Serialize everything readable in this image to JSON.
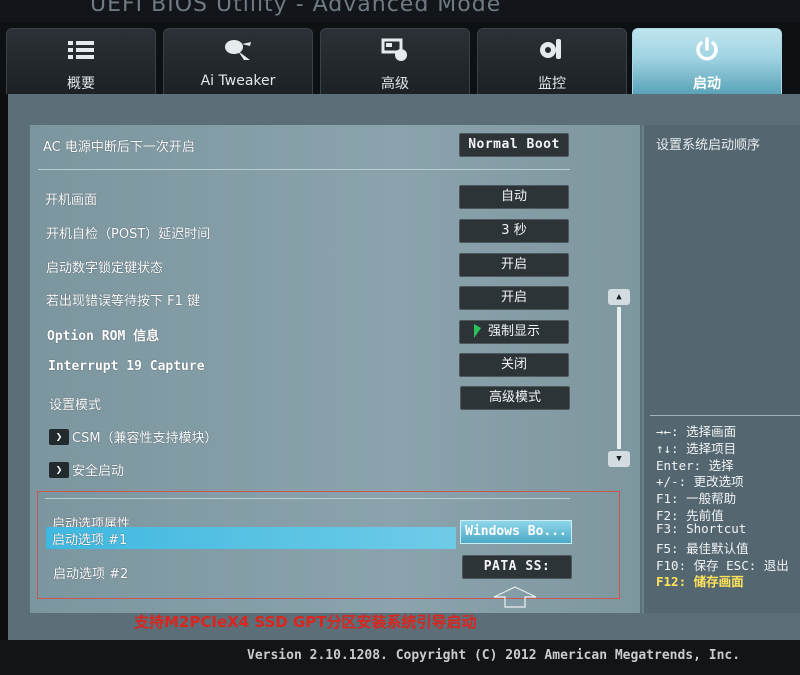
{
  "window": {
    "title": "UEFI BIOS Utility - Advanced Mode"
  },
  "tabs": [
    {
      "label": "概要",
      "icon": "list-icon"
    },
    {
      "label": "Ai Tweaker",
      "icon": "fan-icon"
    },
    {
      "label": "高级",
      "icon": "advanced-icon"
    },
    {
      "label": "监控",
      "icon": "monitor-icon"
    },
    {
      "label": "启动",
      "icon": "power-icon"
    }
  ],
  "settings": {
    "ac_power_label": "AC 电源中断后下一次开启",
    "ac_power_value": "Normal Boot",
    "boot_logo_label": "开机画面",
    "boot_logo_value": "自动",
    "post_delay_label": "开机自检（POST）延迟时间",
    "post_delay_value": "3 秒",
    "numlock_label": "启动数字锁定键状态",
    "numlock_value": "开启",
    "wait_f1_label": "若出现错误等待按下 F1 键",
    "wait_f1_value": "开启",
    "option_rom_label": "Option ROM 信息",
    "option_rom_value": "强制显示",
    "int19_label": "Interrupt 19 Capture",
    "int19_value": "关闭",
    "setup_mode_label": "设置模式",
    "setup_mode_value": "高级模式",
    "csm_label": "CSM（兼容性支持模块）",
    "secure_boot_label": "安全启动"
  },
  "boot_options": {
    "section_label": "启动选项属性",
    "option1_label": "启动选项 #1",
    "option1_value": "Windows Bo...",
    "option2_label": "启动选项 #2",
    "option2_value": "PATA  SS:"
  },
  "help": {
    "description": "设置系统启动顺序",
    "keys": [
      "→←: 选择画面",
      "↑↓: 选择项目",
      "Enter: 选择",
      "+/-: 更改选项",
      "F1: 一般帮助",
      "F2: 先前值",
      "F3: Shortcut",
      "F5: 最佳默认值",
      "F10: 保存  ESC: 退出"
    ],
    "highlight_key": "F12: 储存画面"
  },
  "annotation": "支持M2PCIeX4 SSD GPT分区安装系统引导启动",
  "footer": "Version 2.10.1208. Copyright (C) 2012 American Megatrends, Inc.",
  "colors": {
    "active_tab": "#9fd3e1",
    "selected_row": "#3fb8df",
    "annotation_red": "#d9261f",
    "highlight_key": "#ffe35a"
  }
}
